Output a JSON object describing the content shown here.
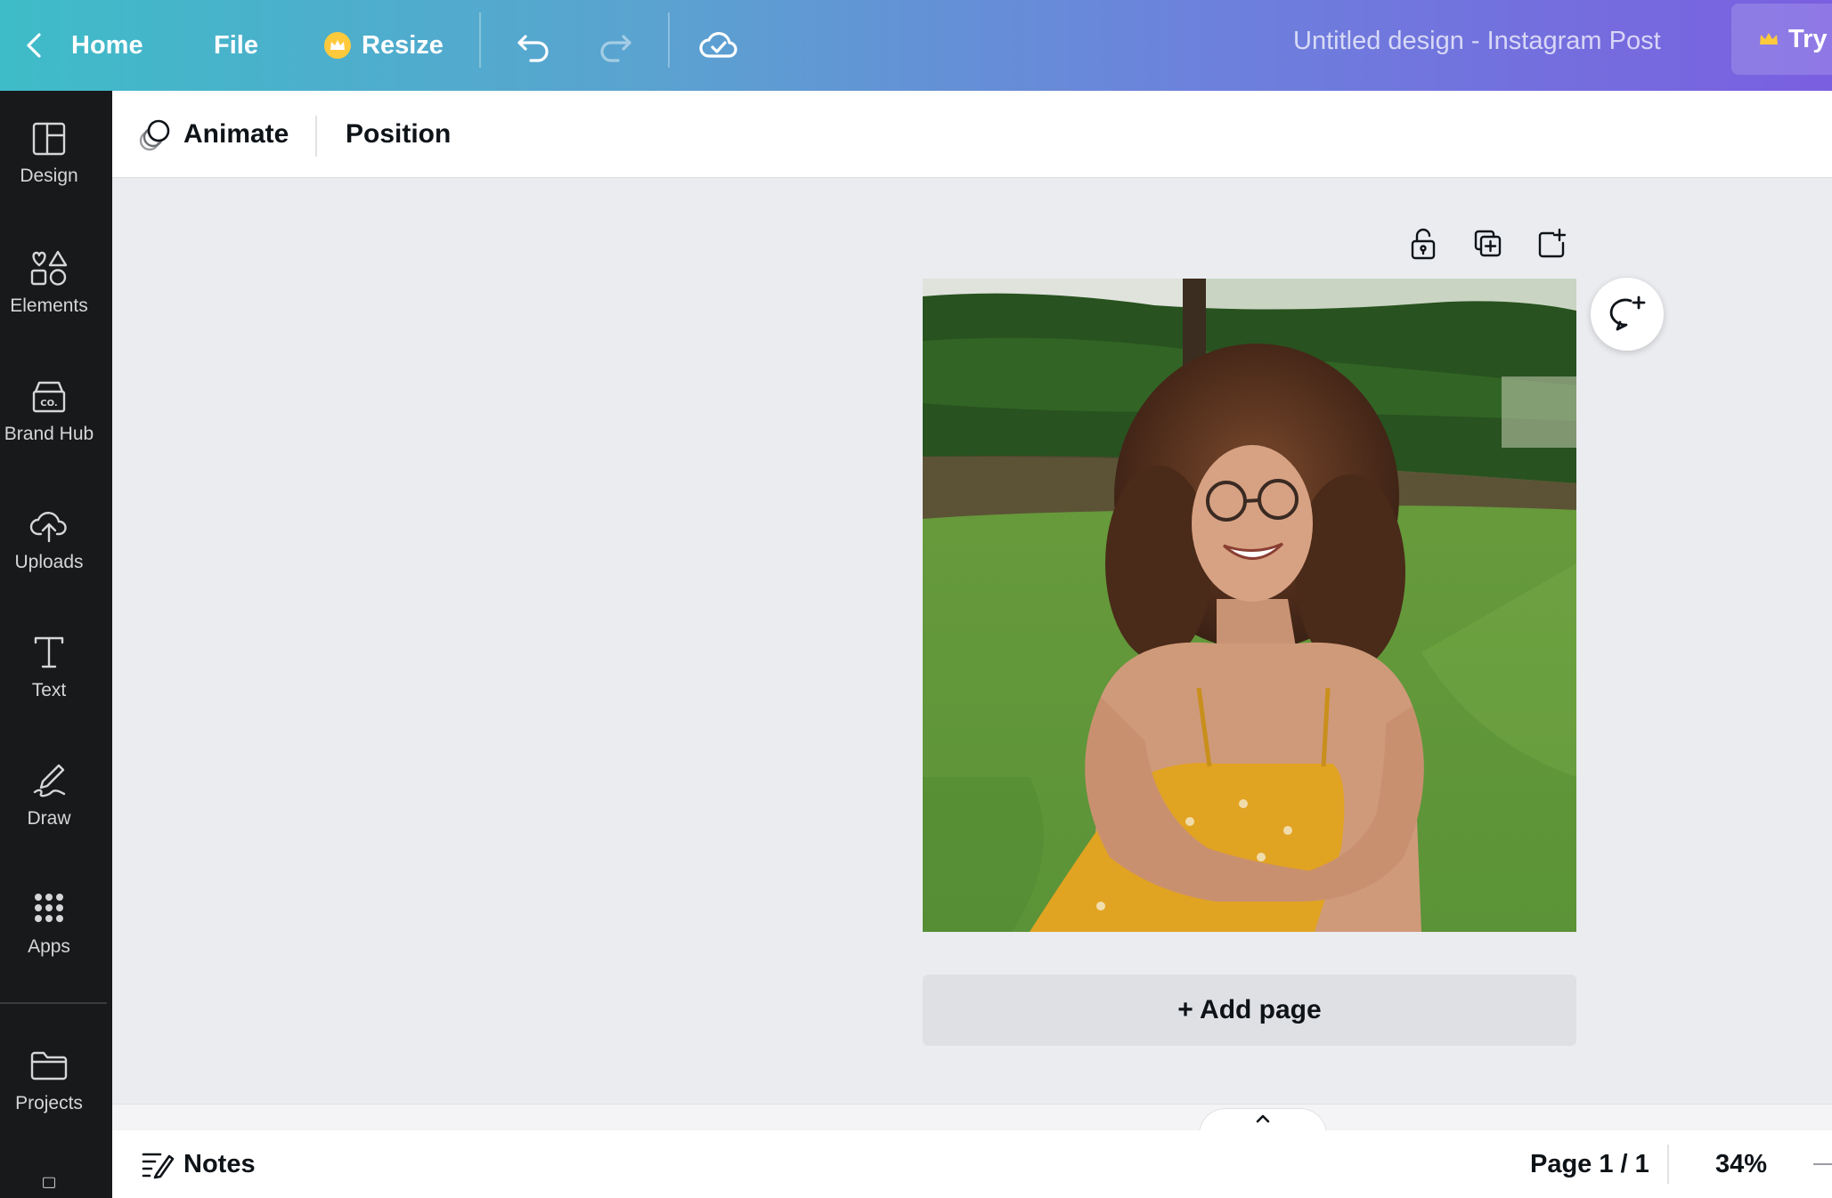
{
  "topbar": {
    "home_label": "Home",
    "file_label": "File",
    "resize_label": "Resize",
    "document_title": "Untitled design - Instagram Post",
    "try_label": "Try"
  },
  "sidebar": {
    "items": [
      {
        "label": "Design",
        "icon": "layout-icon"
      },
      {
        "label": "Elements",
        "icon": "shapes-icon"
      },
      {
        "label": "Brand Hub",
        "icon": "brand-hub-icon"
      },
      {
        "label": "Uploads",
        "icon": "cloud-upload-icon"
      },
      {
        "label": "Text",
        "icon": "text-icon"
      },
      {
        "label": "Draw",
        "icon": "draw-icon"
      },
      {
        "label": "Apps",
        "icon": "apps-grid-icon"
      },
      {
        "label": "Projects",
        "icon": "folder-icon"
      }
    ]
  },
  "context_toolbar": {
    "animate_label": "Animate",
    "position_label": "Position"
  },
  "canvas": {
    "add_page_label": "+ Add page",
    "image_description_icon": "photo-woman-yellow-dress-icon"
  },
  "bottombar": {
    "notes_label": "Notes",
    "page_indicator": "Page 1 / 1",
    "zoom_level": "34%"
  },
  "colors": {
    "topbar_gradient_start": "#3ebcc8",
    "topbar_gradient_end": "#7a5fe0",
    "sidebar_bg": "#18191b",
    "canvas_bg": "#ebecf0",
    "crown": "#ffc93c"
  }
}
